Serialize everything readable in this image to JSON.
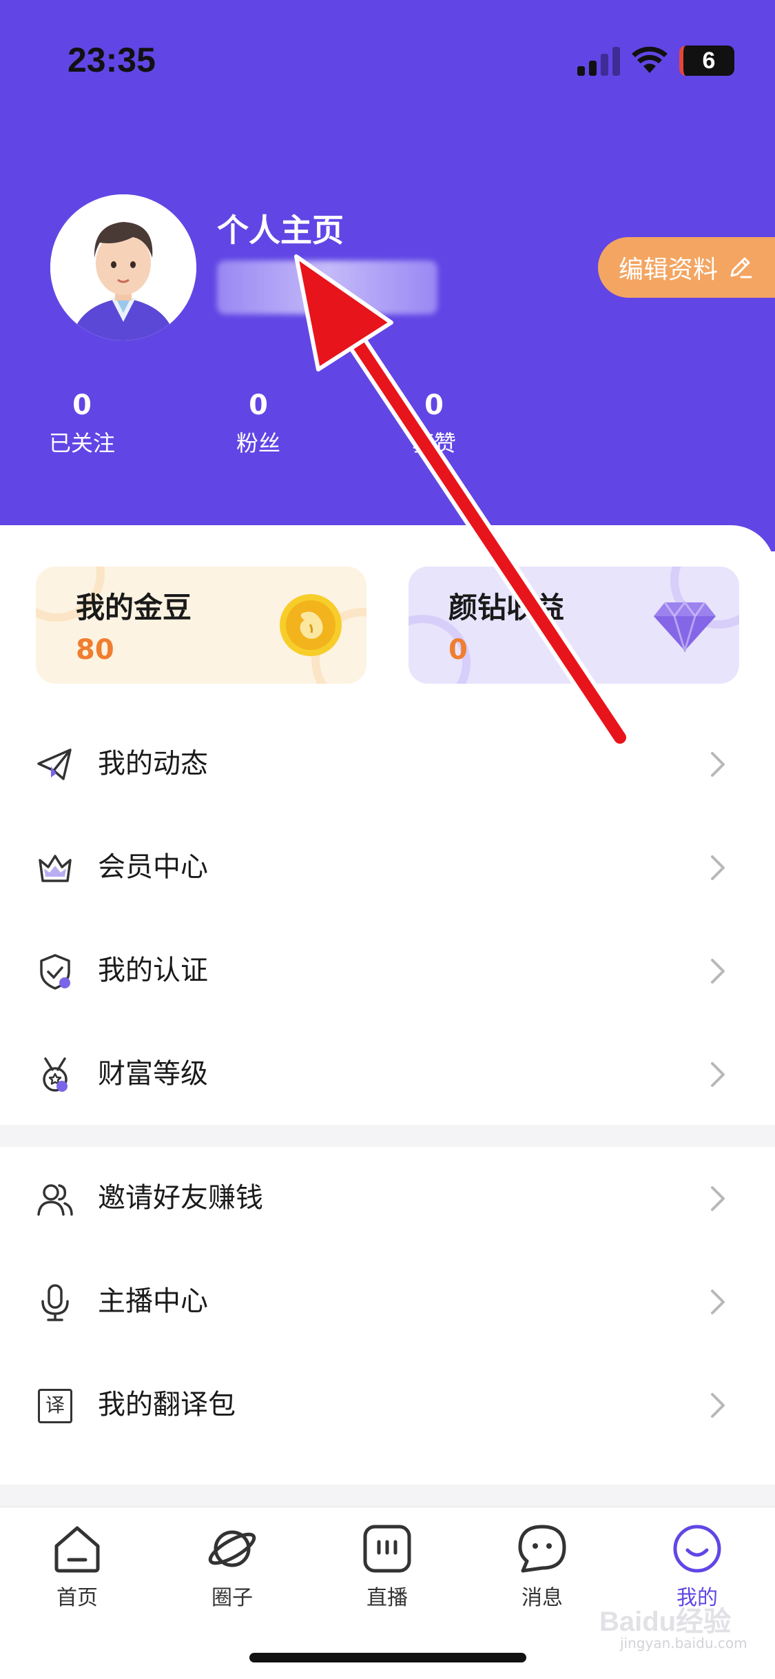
{
  "status_bar": {
    "time": "23:35",
    "battery": "6"
  },
  "profile": {
    "title": "个人主页",
    "edit_label": "编辑资料",
    "stats": [
      {
        "value": "0",
        "label": "已关注"
      },
      {
        "value": "0",
        "label": "粉丝"
      },
      {
        "value": "0",
        "label": "获赞"
      }
    ]
  },
  "cards": {
    "beans": {
      "title": "我的金豆",
      "value": "80"
    },
    "diamond": {
      "title": "颜钻收益",
      "value": "0"
    }
  },
  "menu_group_1": [
    {
      "label": "我的动态",
      "icon": "paper-plane-icon"
    },
    {
      "label": "会员中心",
      "icon": "crown-icon"
    },
    {
      "label": "我的认证",
      "icon": "shield-check-icon"
    },
    {
      "label": "财富等级",
      "icon": "medal-icon"
    }
  ],
  "menu_group_2": [
    {
      "label": "邀请好友赚钱",
      "icon": "users-icon"
    },
    {
      "label": "主播中心",
      "icon": "microphone-icon"
    },
    {
      "label": "我的翻译包",
      "icon": "translate-icon"
    }
  ],
  "translate_icon_glyph": "译",
  "tabs": [
    {
      "label": "首页",
      "icon": "home-icon"
    },
    {
      "label": "圈子",
      "icon": "planet-icon"
    },
    {
      "label": "直播",
      "icon": "live-icon"
    },
    {
      "label": "消息",
      "icon": "message-icon"
    },
    {
      "label": "我的",
      "icon": "me-icon",
      "active": true
    }
  ],
  "watermark": {
    "brand": "Baidu经验",
    "url": "jingyan.baidu.com"
  },
  "colors": {
    "header_purple": "#6146e5",
    "edit_orange": "#f4a561",
    "value_orange": "#ef7e2f",
    "annotation_red": "#e8141b"
  }
}
